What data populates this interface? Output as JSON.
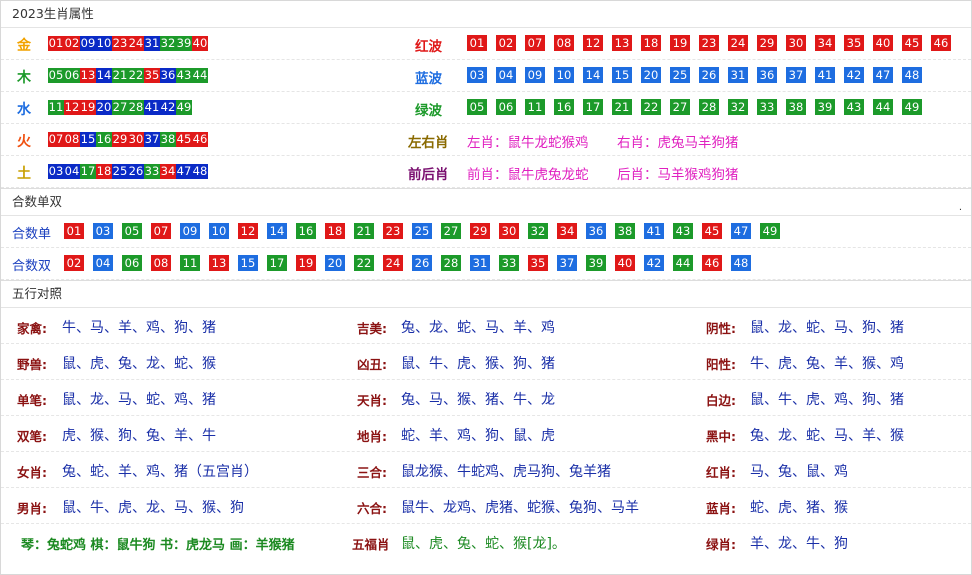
{
  "zodiac": {
    "title": "2023生肖属性",
    "elements": [
      {
        "name": "金",
        "color": "#f2a300",
        "nums": [
          {
            "n": "01",
            "c": "r"
          },
          {
            "n": "02",
            "c": "r"
          },
          {
            "n": "09",
            "c": "nb"
          },
          {
            "n": "10",
            "c": "nb"
          },
          {
            "n": "23",
            "c": "r"
          },
          {
            "n": "24",
            "c": "r"
          },
          {
            "n": "31",
            "c": "nb"
          },
          {
            "n": "32",
            "c": "g"
          },
          {
            "n": "39",
            "c": "g"
          },
          {
            "n": "40",
            "c": "r"
          }
        ]
      },
      {
        "name": "木",
        "color": "#1c9a2a",
        "nums": [
          {
            "n": "05",
            "c": "g"
          },
          {
            "n": "06",
            "c": "g"
          },
          {
            "n": "13",
            "c": "r"
          },
          {
            "n": "14",
            "c": "nb"
          },
          {
            "n": "21",
            "c": "g"
          },
          {
            "n": "22",
            "c": "g"
          },
          {
            "n": "35",
            "c": "r"
          },
          {
            "n": "36",
            "c": "nb"
          },
          {
            "n": "43",
            "c": "g"
          },
          {
            "n": "44",
            "c": "g"
          }
        ]
      },
      {
        "name": "水",
        "color": "#1e6de0",
        "nums": [
          {
            "n": "11",
            "c": "g"
          },
          {
            "n": "12",
            "c": "r"
          },
          {
            "n": "19",
            "c": "r"
          },
          {
            "n": "20",
            "c": "nb"
          },
          {
            "n": "27",
            "c": "g"
          },
          {
            "n": "28",
            "c": "g"
          },
          {
            "n": "41",
            "c": "nb"
          },
          {
            "n": "42",
            "c": "nb"
          },
          {
            "n": "49",
            "c": "g"
          }
        ]
      },
      {
        "name": "火",
        "color": "#f05010",
        "nums": [
          {
            "n": "07",
            "c": "r"
          },
          {
            "n": "08",
            "c": "r"
          },
          {
            "n": "15",
            "c": "nb"
          },
          {
            "n": "16",
            "c": "g"
          },
          {
            "n": "29",
            "c": "r"
          },
          {
            "n": "30",
            "c": "r"
          },
          {
            "n": "37",
            "c": "nb"
          },
          {
            "n": "38",
            "c": "g"
          },
          {
            "n": "45",
            "c": "r"
          },
          {
            "n": "46",
            "c": "r"
          }
        ]
      },
      {
        "name": "土",
        "color": "#c8a000",
        "nums": [
          {
            "n": "03",
            "c": "nb"
          },
          {
            "n": "04",
            "c": "nb"
          },
          {
            "n": "17",
            "c": "g"
          },
          {
            "n": "18",
            "c": "r"
          },
          {
            "n": "25",
            "c": "nb"
          },
          {
            "n": "26",
            "c": "nb"
          },
          {
            "n": "33",
            "c": "g"
          },
          {
            "n": "34",
            "c": "r"
          },
          {
            "n": "47",
            "c": "nb"
          },
          {
            "n": "48",
            "c": "nb"
          }
        ]
      }
    ],
    "waves": [
      {
        "name": "红波",
        "color": "#e01818",
        "cls": "r",
        "nums": [
          "01",
          "02",
          "07",
          "08",
          "12",
          "13",
          "18",
          "19",
          "23",
          "24",
          "29",
          "30",
          "34",
          "35",
          "40",
          "45",
          "46"
        ]
      },
      {
        "name": "蓝波",
        "color": "#1e6de0",
        "cls": "b",
        "nums": [
          "03",
          "04",
          "09",
          "10",
          "14",
          "15",
          "20",
          "25",
          "26",
          "31",
          "36",
          "37",
          "41",
          "42",
          "47",
          "48"
        ]
      },
      {
        "name": "绿波",
        "color": "#1c9a2a",
        "cls": "g",
        "nums": [
          "05",
          "06",
          "11",
          "16",
          "17",
          "21",
          "22",
          "27",
          "28",
          "32",
          "33",
          "38",
          "39",
          "43",
          "44",
          "49"
        ]
      }
    ],
    "lr": {
      "label": "左右肖",
      "left": "左肖：鼠牛龙蛇猴鸡",
      "right": "右肖：虎兔马羊狗猪"
    },
    "fb": {
      "label": "前后肖",
      "front": "前肖：鼠牛虎兔龙蛇",
      "back": "后肖：马羊猴鸡狗猪"
    }
  },
  "heshu": {
    "title": "合数单双",
    "dot": ".",
    "rows": [
      {
        "label": "合数单",
        "nums": [
          {
            "n": "01",
            "c": "r"
          },
          {
            "n": "03",
            "c": "b"
          },
          {
            "n": "05",
            "c": "g"
          },
          {
            "n": "07",
            "c": "r"
          },
          {
            "n": "09",
            "c": "b"
          },
          {
            "n": "10",
            "c": "b"
          },
          {
            "n": "12",
            "c": "r"
          },
          {
            "n": "14",
            "c": "b"
          },
          {
            "n": "16",
            "c": "g"
          },
          {
            "n": "18",
            "c": "r"
          },
          {
            "n": "21",
            "c": "g"
          },
          {
            "n": "23",
            "c": "r"
          },
          {
            "n": "25",
            "c": "b"
          },
          {
            "n": "27",
            "c": "g"
          },
          {
            "n": "29",
            "c": "r"
          },
          {
            "n": "30",
            "c": "r"
          },
          {
            "n": "32",
            "c": "g"
          },
          {
            "n": "34",
            "c": "r"
          },
          {
            "n": "36",
            "c": "b"
          },
          {
            "n": "38",
            "c": "g"
          },
          {
            "n": "41",
            "c": "b"
          },
          {
            "n": "43",
            "c": "g"
          },
          {
            "n": "45",
            "c": "r"
          },
          {
            "n": "47",
            "c": "b"
          },
          {
            "n": "49",
            "c": "g"
          }
        ]
      },
      {
        "label": "合数双",
        "nums": [
          {
            "n": "02",
            "c": "r"
          },
          {
            "n": "04",
            "c": "b"
          },
          {
            "n": "06",
            "c": "g"
          },
          {
            "n": "08",
            "c": "r"
          },
          {
            "n": "11",
            "c": "g"
          },
          {
            "n": "13",
            "c": "r"
          },
          {
            "n": "15",
            "c": "b"
          },
          {
            "n": "17",
            "c": "g"
          },
          {
            "n": "19",
            "c": "r"
          },
          {
            "n": "20",
            "c": "b"
          },
          {
            "n": "22",
            "c": "g"
          },
          {
            "n": "24",
            "c": "r"
          },
          {
            "n": "26",
            "c": "b"
          },
          {
            "n": "28",
            "c": "g"
          },
          {
            "n": "31",
            "c": "b"
          },
          {
            "n": "33",
            "c": "g"
          },
          {
            "n": "35",
            "c": "r"
          },
          {
            "n": "37",
            "c": "b"
          },
          {
            "n": "39",
            "c": "g"
          },
          {
            "n": "40",
            "c": "r"
          },
          {
            "n": "42",
            "c": "b"
          },
          {
            "n": "44",
            "c": "g"
          },
          {
            "n": "46",
            "c": "r"
          },
          {
            "n": "48",
            "c": "b"
          }
        ]
      }
    ]
  },
  "wuxing": {
    "title": "五行对照",
    "rows": [
      [
        {
          "l": "家禽:",
          "v": "牛、马、羊、鸡、狗、猪"
        },
        {
          "l": "吉美:",
          "v": "兔、龙、蛇、马、羊、鸡"
        },
        {
          "l": "阴性:",
          "v": "鼠、龙、蛇、马、狗、猪"
        }
      ],
      [
        {
          "l": "野兽:",
          "v": "鼠、虎、兔、龙、蛇、猴"
        },
        {
          "l": "凶丑:",
          "v": "鼠、牛、虎、猴、狗、猪"
        },
        {
          "l": "阳性:",
          "v": "牛、虎、兔、羊、猴、鸡"
        }
      ],
      [
        {
          "l": "单笔:",
          "v": "鼠、龙、马、蛇、鸡、猪"
        },
        {
          "l": "天肖:",
          "v": "兔、马、猴、猪、牛、龙"
        },
        {
          "l": "白边:",
          "v": "鼠、牛、虎、鸡、狗、猪"
        }
      ],
      [
        {
          "l": "双笔:",
          "v": "虎、猴、狗、兔、羊、牛"
        },
        {
          "l": "地肖:",
          "v": "蛇、羊、鸡、狗、鼠、虎"
        },
        {
          "l": "黑中:",
          "v": "兔、龙、蛇、马、羊、猴"
        }
      ],
      [
        {
          "l": "女肖:",
          "v": "兔、蛇、羊、鸡、猪（五宫肖）"
        },
        {
          "l": "三合:",
          "v": "鼠龙猴、牛蛇鸡、虎马狗、兔羊猪"
        },
        {
          "l": "红肖:",
          "v": "马、兔、鼠、鸡"
        }
      ],
      [
        {
          "l": "男肖:",
          "v": "鼠、牛、虎、龙、马、猴、狗"
        },
        {
          "l": "六合:",
          "v": "鼠牛、龙鸡、虎猪、蛇猴、兔狗、马羊"
        },
        {
          "l": "蓝肖:",
          "v": "蛇、虎、猪、猴"
        }
      ]
    ],
    "last": {
      "arts": "琴：兔蛇鸡 棋：鼠牛狗 书：虎龙马 画：羊猴猪",
      "fuLabel": "五福肖",
      "fuVal": "鼠、虎、兔、蛇、猴[龙]。",
      "greenLabel": "绿肖:",
      "greenVal": "羊、龙、牛、狗"
    }
  }
}
